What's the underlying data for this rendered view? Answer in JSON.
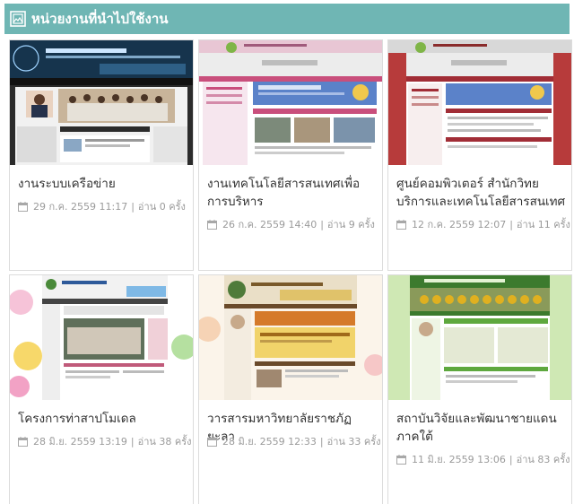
{
  "section": {
    "title": "หน่วยงานที่นำไปใช้งาน",
    "icon": "framed-picture-icon",
    "accent": "#6fb6b4"
  },
  "cards": [
    {
      "title": "งานระบบเครือข่าย",
      "date": "29 ก.ค. 2559 11:17",
      "views": "อ่าน 0 ครั้ง",
      "thumb_theme": "#1b2a3a",
      "thumb_site_title": "งานระบบเครือข่าย"
    },
    {
      "title": "งานเทคโนโลยีสารสนเทศเพื่อการบริหาร",
      "date": "26 ก.ค. 2559 14:40",
      "views": "อ่าน 9 ครั้ง",
      "thumb_theme": "#e8c6d4",
      "thumb_site_title": "BACKOFFICE (Fiscal year 59)"
    },
    {
      "title": "ศูนย์คอมพิวเตอร์ สำนักวิทยบริการและเทคโนโลยีสารสนเทศ",
      "date": "12 ก.ค. 2559 12:07",
      "views": "อ่าน 11 ครั้ง",
      "thumb_theme": "#b73b3b",
      "thumb_site_title": "BACKOFFICE (Fiscal year 59)"
    },
    {
      "title": "โครงการท่าสาปโมเดล",
      "date": "28 มิ.ย. 2559 13:19",
      "views": "อ่าน 38 ครั้ง",
      "thumb_theme": "#f4f4f4",
      "thumb_site_title": "Tasap Model"
    },
    {
      "title": "วารสารมหาวิทยาลัยราชภัฏยะลา",
      "date": "28 มิ.ย. 2559 12:33",
      "views": "อ่าน 33 ครั้ง",
      "thumb_theme": "#f3e2c8",
      "thumb_site_title": "วารสารมหาวิทยาลัยราชภัฏยะลา"
    },
    {
      "title": "สถาบันวิจัยและพัฒนาชายแดนภาคใต้",
      "date": "11 มิ.ย. 2559 13:06",
      "views": "อ่าน 83 ครั้ง",
      "thumb_theme": "#cfe8b4",
      "thumb_site_title": "สถาบันวิจัยและพัฒนาชายแดนภาคใต้"
    }
  ]
}
